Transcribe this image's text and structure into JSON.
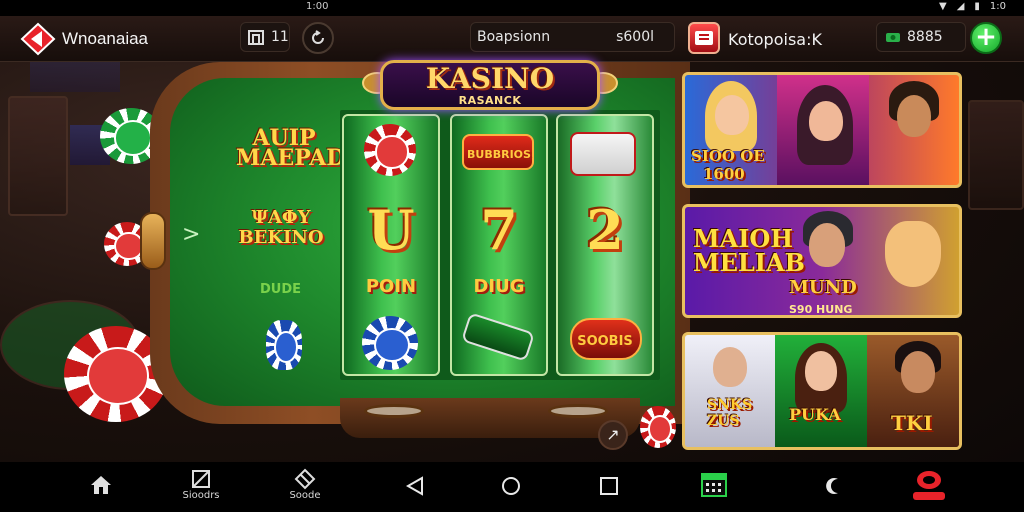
{
  "status_bar": {
    "time": "1:00",
    "right": "1:0"
  },
  "app_bar": {
    "brand_name": "Wnoanaiaa",
    "wallet_label": "11",
    "balance_label": "Boapsionn",
    "balance_value": "s600l",
    "shop_label": "Kotopoisa:K",
    "coins_value": "8885",
    "add_label": "+"
  },
  "main_banner": {
    "title": "KASINO",
    "subtitle": "RASANCK"
  },
  "left_column": {
    "symbol_1": "AUIP MAEPADES",
    "symbol_2": "ΨΑΦΥ BEKINO",
    "tag": "DUDE"
  },
  "reels": {
    "reel_1": {
      "digit": "U",
      "word": "POIN"
    },
    "reel_2": {
      "digit": "7",
      "word": "DIUG",
      "top_label": "BUBBRIOS"
    },
    "reel_3": {
      "digit": "2",
      "bottom_label": "SOOBIS"
    }
  },
  "game_cards": [
    {
      "title": "SIOO OE",
      "subtitle": "1600"
    },
    {
      "title": "MAIOH MELIAB",
      "badge": "MUND",
      "footer": "S90 HUNG"
    },
    {
      "title": "SNKS ZUS",
      "badge": "PUKA",
      "tag": "TKI"
    }
  ],
  "bottom_nav": [
    {
      "label": "",
      "icon": "home-icon"
    },
    {
      "label": "Sioodrs",
      "icon": "gift-icon"
    },
    {
      "label": "Soode",
      "icon": "tag-icon"
    },
    {
      "label": "",
      "icon": "back-icon"
    },
    {
      "label": "",
      "icon": "home-circle-icon"
    },
    {
      "label": "",
      "icon": "recents-icon"
    },
    {
      "label": "",
      "icon": "calendar-icon"
    },
    {
      "label": "",
      "icon": "moon-icon"
    },
    {
      "label": "",
      "icon": "profile-icon"
    }
  ],
  "colors": {
    "felt": "#1f8a2d",
    "accent_gold": "#ffd76a",
    "add_green": "#15a82a",
    "shop_red": "#d01a22"
  }
}
